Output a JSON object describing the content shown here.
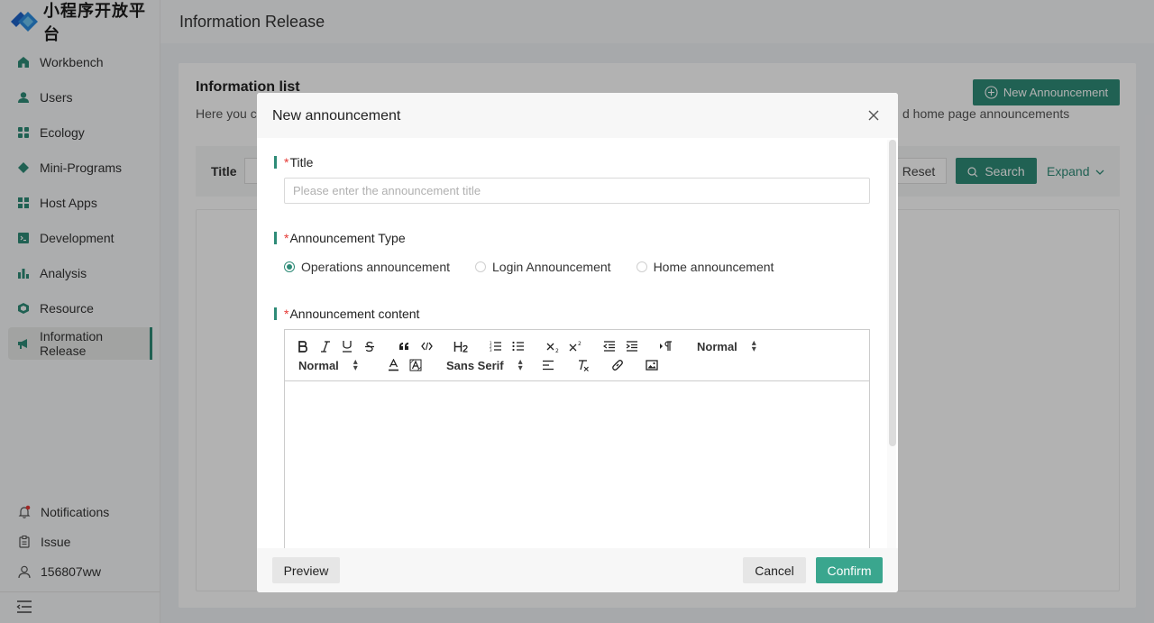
{
  "brand": {
    "name": "小程序开放平台"
  },
  "header": {
    "title": "Information Release"
  },
  "sidebar": {
    "items": [
      {
        "label": "Workbench",
        "icon": "home-icon"
      },
      {
        "label": "Users",
        "icon": "user-icon"
      },
      {
        "label": "Ecology",
        "icon": "grid-icon"
      },
      {
        "label": "Mini-Programs",
        "icon": "diamond-icon"
      },
      {
        "label": "Host Apps",
        "icon": "apps-icon"
      },
      {
        "label": "Development",
        "icon": "code-icon"
      },
      {
        "label": "Analysis",
        "icon": "bar-chart-icon"
      },
      {
        "label": "Resource",
        "icon": "cube-icon"
      },
      {
        "label": "Information Release",
        "icon": "megaphone-icon",
        "active": true
      }
    ],
    "bottom": {
      "notifications": "Notifications",
      "issue": "Issue",
      "user": "156807ww"
    }
  },
  "main": {
    "list_title": "Information list",
    "desc_left": "Here you ca",
    "desc_right": "d home page announcements",
    "new_button": "New Announcement",
    "filter": {
      "title_label": "Title",
      "reset": "Reset",
      "search": "Search",
      "expand": "Expand"
    }
  },
  "modal": {
    "title": "New announcement",
    "fields": {
      "title_label": "Title",
      "title_placeholder": "Please enter the announcement title",
      "type_label": "Announcement Type",
      "type_options": [
        "Operations announcement",
        "Login Announcement",
        "Home announcement"
      ],
      "type_selected": "Operations announcement",
      "content_label": "Announcement content",
      "required_mark": "*"
    },
    "toolbar": {
      "heading_select": "Normal",
      "size_select": "Normal",
      "font_select": "Sans Serif"
    },
    "footer": {
      "preview": "Preview",
      "cancel": "Cancel",
      "confirm": "Confirm"
    }
  },
  "colors": {
    "accent": "#2e8b77",
    "confirm": "#3aa68e",
    "required": "#e53935"
  }
}
